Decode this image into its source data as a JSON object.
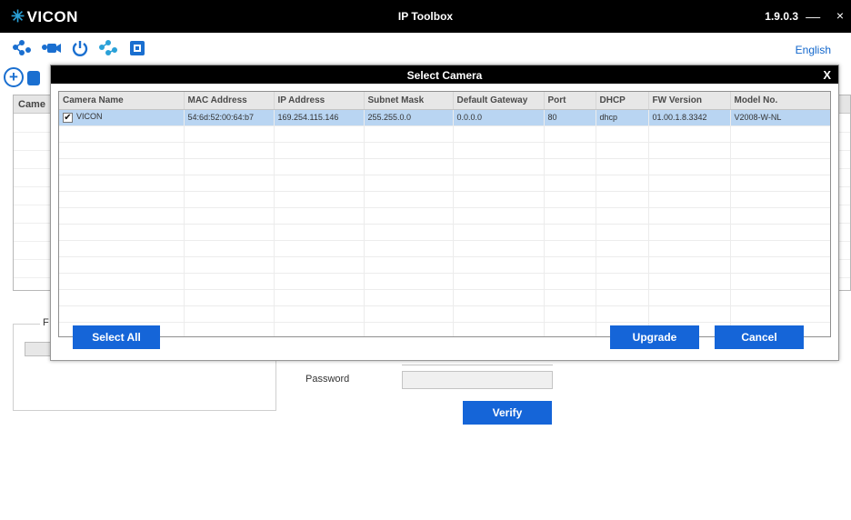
{
  "window": {
    "brand": "VICON",
    "title": "IP Toolbox",
    "version": "1.9.0.3",
    "minimize": "__",
    "close": "×"
  },
  "toolbar": {
    "icons": [
      "device-discovery-icon",
      "camera-icon",
      "power-icon",
      "network-icon",
      "firmware-icon"
    ],
    "language": "English"
  },
  "background_page": {
    "add_icon": "+",
    "table_header_first": "Came",
    "groupbox_legend": "F",
    "password_label": "Password",
    "verify_button": "Verify"
  },
  "dialog": {
    "title": "Select Camera",
    "close": "X",
    "columns": [
      "Camera Name",
      "MAC Address",
      "IP Address",
      "Subnet Mask",
      "Default Gateway",
      "Port",
      "DHCP",
      "FW Version",
      "Model No."
    ],
    "rows": [
      {
        "checked": true,
        "camera_name": "VICON",
        "mac": "54:6d:52:00:64:b7",
        "ip": "169.254.115.146",
        "subnet": "255.255.0.0",
        "gateway": "0.0.0.0",
        "port": "80",
        "dhcp": "dhcp",
        "fw": "01.00.1.8.3342",
        "model": "V2008-W-NL"
      }
    ],
    "select_all": "Select All",
    "upgrade": "Upgrade",
    "cancel": "Cancel"
  },
  "colors": {
    "accent": "#1565d8",
    "selected_row": "#b9d5f2",
    "titlebar": "#000000"
  }
}
